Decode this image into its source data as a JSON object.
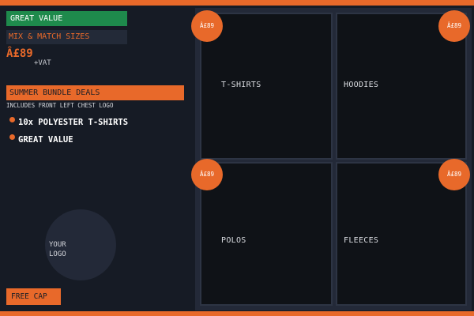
{
  "tags": {
    "great_value": "GREAT VALUE",
    "mix_match": "MIX & MATCH SIZES"
  },
  "price": {
    "amount": "Â£89",
    "vat": "+VAT"
  },
  "bundle": {
    "title": "SUMMER BUNDLE DEALS",
    "subtitle": "INCLUDES FRONT LEFT CHEST LOGO",
    "features": [
      "10x POLYESTER T-SHIRTS",
      "GREAT VALUE"
    ]
  },
  "logo_placeholder": {
    "line1": "YOUR",
    "line2": "LOGO"
  },
  "free_cap": "FREE CAP",
  "products": [
    {
      "label": "T-SHIRTS",
      "badge": "Â£89"
    },
    {
      "label": "HOODIES",
      "badge": "Â£89"
    },
    {
      "label": "POLOS",
      "badge": "Â£89"
    },
    {
      "label": "FLEECES",
      "badge": "Â£89"
    }
  ],
  "colors": {
    "accent": "#e8692a",
    "green": "#1e8a4c",
    "background": "#161b25"
  }
}
